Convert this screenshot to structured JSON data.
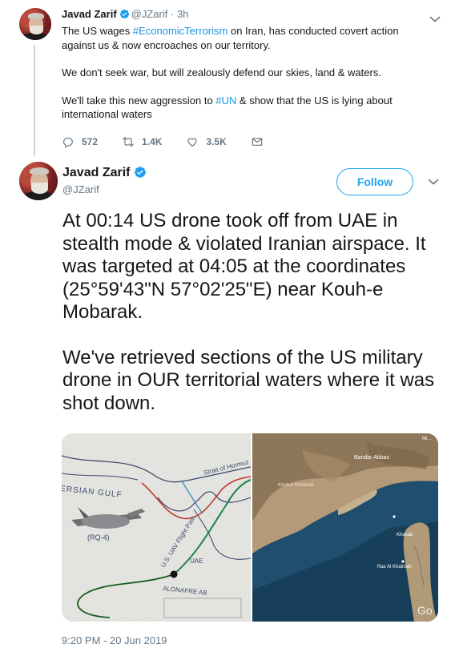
{
  "parent_tweet": {
    "author_name": "Javad Zarif",
    "handle_time": "@JZarif · 3h",
    "paragraphs": [
      [
        {
          "text": "The US wages ",
          "tag": false
        },
        {
          "text": "#EconomicTerrorism",
          "tag": true
        },
        {
          "text": " on Iran, has conducted covert action against us & now encroaches on our territory.",
          "tag": false
        }
      ],
      [
        {
          "text": "We don't seek war, but will zealously defend our skies, land & waters.",
          "tag": false
        }
      ],
      [
        {
          "text": "We'll take this new aggression to ",
          "tag": false
        },
        {
          "text": "#UN",
          "tag": true
        },
        {
          "text": " & show that the US is lying about international waters",
          "tag": false
        }
      ]
    ],
    "actions": {
      "reply_count": "572",
      "retweet_count": "1.4K",
      "like_count": "3.5K"
    }
  },
  "main_tweet": {
    "author_name": "Javad Zarif",
    "handle": "@JZarif",
    "follow_label": "Follow",
    "paragraphs": [
      "At 00:14 US drone took off from UAE in stealth mode & violated Iranian airspace. It was targeted at 04:05 at the coordinates (25°59'43\"N 57°02'25\"E) near Kouh-e Mobarak.",
      "We've retrieved sections of the US military drone in OUR territorial waters where it was shot down."
    ],
    "timestamp": "9:20 PM - 20 Jun 2019"
  },
  "media": {
    "map_labels": {
      "strait": "Strait of Hormuz",
      "gulf": "ERSIAN GULF",
      "rq4": "(RQ-4)",
      "route": "U.S. UAV Flight Path",
      "uae": "UAE",
      "alonafre": "ALONAFRE AB"
    },
    "satellite_labels": {
      "bandar_abbas": "Bandar Abbas",
      "kouh_mobarak": "Kouh-e Mobarak",
      "khasab": "Khasab",
      "ras_al_khaimah": "Ras Al Khaimah",
      "google": "Go",
      "corner": "Mi…"
    }
  },
  "colors": {
    "link": "#1b95e0",
    "follow_blue": "#1da1f2",
    "muted": "#657786",
    "text": "#14171a"
  }
}
